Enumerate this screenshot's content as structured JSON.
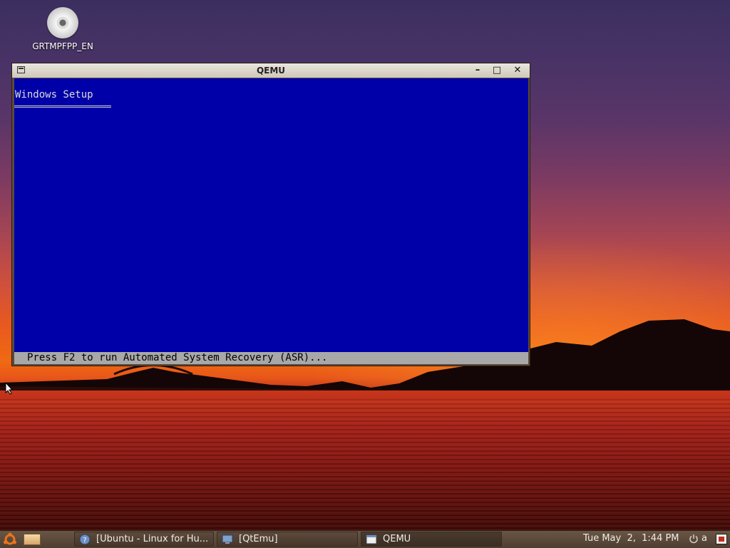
{
  "desktop": {
    "icons": [
      {
        "label": "GRTMPFPP_EN",
        "icon": "cd-disc-icon"
      }
    ]
  },
  "window": {
    "title": "QEMU",
    "buttons": {
      "minimize": "–",
      "maximize": "□",
      "close": "✕"
    },
    "screen": {
      "heading": "Windows Setup",
      "status_text": "Press F2 to run Automated System Recovery (ASR)...",
      "background_color": "#0000a8",
      "status_background_color": "#a8a8a8"
    }
  },
  "taskbar": {
    "tasks": [
      {
        "label": "[Ubuntu - Linux for Hu...",
        "icon": "browser-help-icon",
        "active": false
      },
      {
        "label": "[QtEmu]",
        "icon": "monitor-icon",
        "active": false
      },
      {
        "label": "QEMU",
        "icon": "window-icon",
        "active": true
      }
    ],
    "clock": "Tue May  2,  1:44 PM",
    "keyboard_indicator": "a"
  }
}
